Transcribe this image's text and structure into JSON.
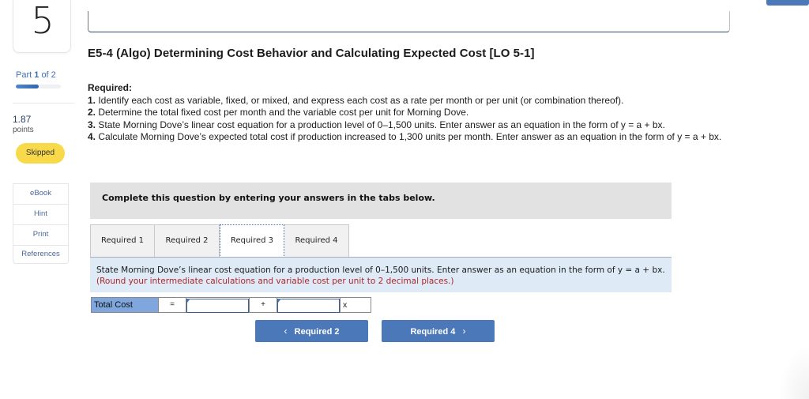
{
  "sidebar": {
    "question_number": "5",
    "part_label_prefix": "Part",
    "part_current": "1",
    "part_label_suffix": "of 2",
    "part_progress": 0.5,
    "points_value": "1.87",
    "points_label": "points",
    "status_badge": "Skipped",
    "tools": [
      {
        "label": "eBook"
      },
      {
        "label": "Hint"
      },
      {
        "label": "Print"
      },
      {
        "label": "References"
      }
    ]
  },
  "problem": {
    "title": "E5-4 (Algo) Determining Cost Behavior and Calculating Expected Cost [LO 5-1]",
    "required_heading": "Required:",
    "requirements": [
      {
        "num": "1.",
        "text": " Identify each cost as variable, fixed, or mixed, and express each cost as a rate per month or per unit (or combination thereof)."
      },
      {
        "num": "2.",
        "text": " Determine the total fixed cost per month and the variable cost per unit for Morning Dove."
      },
      {
        "num": "3.",
        "text": " State Morning Dove’s linear cost equation for a production level of 0–1,500 units. Enter answer as an equation in the form of y = a + bx."
      },
      {
        "num": "4.",
        "text": " Calculate Morning Dove’s expected total cost if production increased to 1,300 units per month. Enter answer as an equation in the form of y = a + bx."
      }
    ]
  },
  "instruction_banner": "Complete this question by entering your answers in the tabs below.",
  "tabs": [
    {
      "label": "Required 1",
      "active": false
    },
    {
      "label": "Required 2",
      "active": false
    },
    {
      "label": "Required 3",
      "active": true
    },
    {
      "label": "Required 4",
      "active": false
    }
  ],
  "tab_panel": {
    "text": "State Morning Dove’s linear cost equation for a production level of 0–1,500 units. Enter answer as an equation in the form of y = a + bx. ",
    "hint": "(Round your intermediate calculations and variable cost per unit to 2 decimal places.)"
  },
  "equation": {
    "label": "Total Cost",
    "equals": "=",
    "fixed_cost_value": "",
    "plus": "+",
    "variable_rate_value": "",
    "x_symbol": "x"
  },
  "navigation": {
    "prev_label": "Required 2",
    "prev_icon": "‹",
    "next_label": "Required 4",
    "next_icon": "›"
  },
  "colors": {
    "accent": "#4a78b8",
    "badge_skipped": "#f8d94a",
    "hint_red": "#b0242a",
    "panel_bg": "#deeaf6",
    "equation_label_bg": "#7fa7de"
  }
}
